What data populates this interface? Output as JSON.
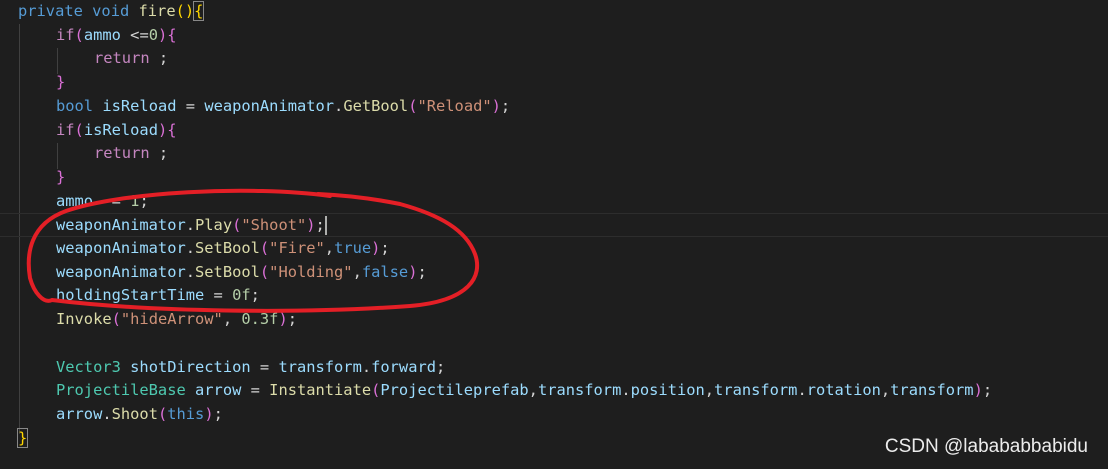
{
  "code_lines": [
    [
      [
        "kw",
        "private"
      ],
      [
        "",
        "Ƅ"
      ],
      [
        "kw",
        "void"
      ],
      [
        "",
        "Ƅ"
      ],
      [
        "fn",
        "fire"
      ],
      [
        "p1",
        "("
      ],
      [
        "p1",
        "bracket-close"
      ],
      [
        "p1",
        "{"
      ]
    ],
    [
      [
        "ctl",
        "if"
      ],
      [
        "p2",
        "("
      ],
      [
        "var",
        "ammo"
      ],
      [
        "",
        "Ƅ<="
      ],
      [
        "num",
        "0"
      ],
      [
        "p2",
        ")"
      ],
      [
        "p2",
        "{"
      ]
    ],
    [
      [
        "ctl",
        "return"
      ],
      [
        "",
        "Ƅ;"
      ]
    ],
    [
      [
        "p2",
        "}"
      ]
    ],
    [
      [
        "kw",
        "bool"
      ],
      [
        "",
        "Ƅ"
      ],
      [
        "var",
        "isReload"
      ],
      [
        "",
        "Ƅ=Ƅ"
      ],
      [
        "var",
        "weaponAnimator"
      ],
      [
        "",
        "."
      ],
      [
        "fn",
        "GetBool"
      ],
      [
        "p2",
        "("
      ],
      [
        "str",
        "\"Reload\""
      ],
      [
        "p2",
        ")"
      ],
      [
        "",
        ";"
      ]
    ],
    [
      [
        "ctl",
        "if"
      ],
      [
        "p2",
        "("
      ],
      [
        "var",
        "isReload"
      ],
      [
        "p2",
        ")"
      ],
      [
        "p2",
        "{"
      ]
    ],
    [
      [
        "ctl",
        "return"
      ],
      [
        "",
        "Ƅ;"
      ]
    ],
    [
      [
        "p2",
        "}"
      ]
    ],
    [
      [
        "var",
        "ammo"
      ],
      [
        "",
        "Ƅ-=Ƅ"
      ],
      [
        "num",
        "1"
      ],
      [
        "",
        ";"
      ]
    ],
    [
      [
        "var",
        "weaponAnimator"
      ],
      [
        "",
        "."
      ],
      [
        "fn",
        "Play"
      ],
      [
        "p2",
        "("
      ],
      [
        "str",
        "\"Shoot\""
      ],
      [
        "p2",
        ")"
      ],
      [
        "",
        ";"
      ]
    ],
    [
      [
        "var",
        "weaponAnimator"
      ],
      [
        "",
        "."
      ],
      [
        "fn",
        "SetBool"
      ],
      [
        "p2",
        "("
      ],
      [
        "str",
        "\"Fire\""
      ],
      [
        "",
        ","
      ],
      [
        "kw",
        "true"
      ],
      [
        "p2",
        ")"
      ],
      [
        "",
        ";"
      ]
    ],
    [
      [
        "var",
        "weaponAnimator"
      ],
      [
        "",
        "."
      ],
      [
        "fn",
        "SetBool"
      ],
      [
        "p2",
        "("
      ],
      [
        "str",
        "\"Holding\""
      ],
      [
        "",
        ","
      ],
      [
        "kw",
        "false"
      ],
      [
        "p2",
        ")"
      ],
      [
        "",
        ";"
      ]
    ],
    [
      [
        "var",
        "holdingStartTime"
      ],
      [
        "",
        "Ƅ=Ƅ"
      ],
      [
        "num",
        "0f"
      ],
      [
        "",
        ";"
      ]
    ],
    [
      [
        "fn",
        "Invoke"
      ],
      [
        "p2",
        "("
      ],
      [
        "str",
        "\"hideArrow\""
      ],
      [
        "",
        ",Ƅ"
      ],
      [
        "num",
        "0.3f"
      ],
      [
        "p2",
        ")"
      ],
      [
        "",
        ";"
      ]
    ],
    [],
    [
      [
        "type",
        "Vector3"
      ],
      [
        "",
        "Ƅ"
      ],
      [
        "var",
        "shotDirection"
      ],
      [
        "",
        "Ƅ=Ƅ"
      ],
      [
        "var",
        "transform"
      ],
      [
        "",
        "."
      ],
      [
        "var",
        "forward"
      ],
      [
        "",
        ";"
      ]
    ],
    [
      [
        "type",
        "ProjectileBase"
      ],
      [
        "",
        "Ƅ"
      ],
      [
        "var",
        "arrow"
      ],
      [
        "",
        "Ƅ=Ƅ"
      ],
      [
        "fn",
        "Instantiate"
      ],
      [
        "p2",
        "("
      ],
      [
        "var",
        "Projectileprefab"
      ],
      [
        "",
        ","
      ],
      [
        "var",
        "transform"
      ],
      [
        "",
        "."
      ],
      [
        "var",
        "position"
      ],
      [
        "",
        ","
      ],
      [
        "var",
        "transform"
      ],
      [
        "",
        "."
      ],
      [
        "var",
        "rotation"
      ],
      [
        "",
        ","
      ],
      [
        "var",
        "transform"
      ],
      [
        "p2",
        ")"
      ],
      [
        "",
        ";"
      ]
    ],
    [
      [
        "var",
        "arrow"
      ],
      [
        "",
        "."
      ],
      [
        "fn",
        "Shoot"
      ],
      [
        "p2",
        "("
      ],
      [
        "kw",
        "this"
      ],
      [
        "p2",
        ")"
      ],
      [
        "",
        ";"
      ]
    ],
    [
      [
        "p1",
        "}"
      ]
    ]
  ],
  "indent_levels": [
    0,
    1,
    2,
    1,
    1,
    1,
    2,
    1,
    1,
    1,
    1,
    1,
    1,
    1,
    0,
    1,
    1,
    1,
    0
  ],
  "current_line": 9,
  "matched_bracket_line": 18,
  "watermark": "CSDN @labababbabidu"
}
